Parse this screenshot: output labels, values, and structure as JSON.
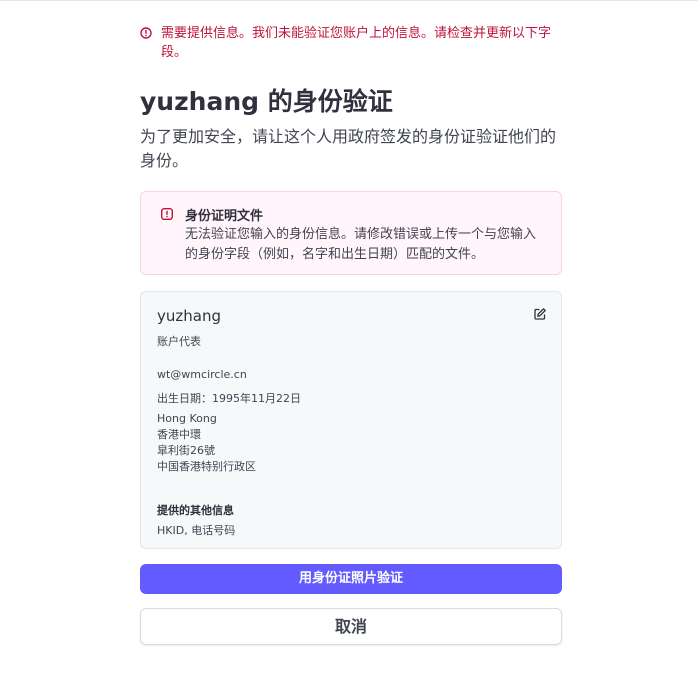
{
  "error_banner": {
    "text": "需要提供信息。我们未能验证您账户上的信息。请检查并更新以下字段。"
  },
  "header": {
    "title": "yuzhang 的身份验证",
    "subtitle": "为了更加安全，请让这个人用政府签发的身份证验证他们的身份。"
  },
  "alert": {
    "title": "身份证明文件",
    "body": "无法验证您输入的身份信息。请修改错误或上传一个与您输入的身份字段（例如，名字和出生日期）匹配的文件。"
  },
  "person": {
    "name": "yuzhang",
    "role": "账户代表",
    "email": "wt@wmcircle.cn",
    "dob": "出生日期：1995年11月22日",
    "address": [
      "Hong Kong",
      "香港中環",
      "皐利街26號",
      "中国香港特别行政区"
    ],
    "other_heading": "提供的其他信息",
    "other_value": "HKID, 电话号码"
  },
  "actions": {
    "verify_label": "用身份证照片验证",
    "cancel_label": "取消"
  },
  "colors": {
    "error": "#c0123c",
    "accent": "#635bff",
    "alert_bg": "#fff5fa",
    "card_bg": "#f6f8fa"
  },
  "icons": {
    "error": "alert-circle-icon",
    "edit": "edit-pencil-icon"
  }
}
